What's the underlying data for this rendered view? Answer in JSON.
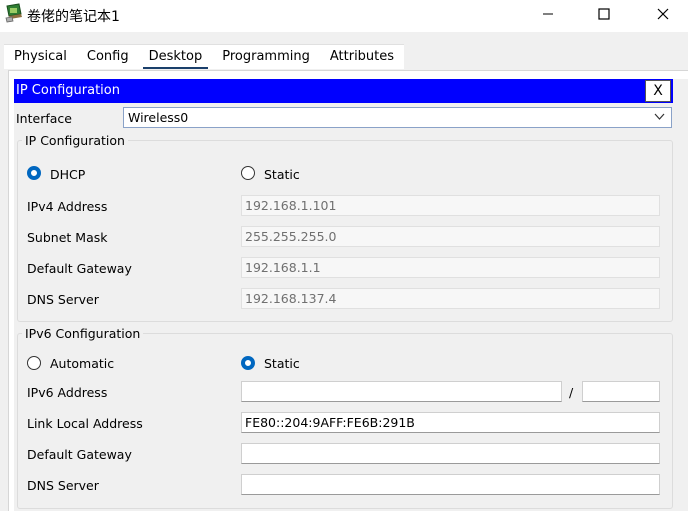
{
  "window": {
    "title": "卷佬的笔记本1"
  },
  "tabs": [
    {
      "label": "Physical"
    },
    {
      "label": "Config"
    },
    {
      "label": "Desktop"
    },
    {
      "label": "Programming"
    },
    {
      "label": "Attributes"
    }
  ],
  "active_tab": "Desktop",
  "ip_config": {
    "header_title": "IP Configuration",
    "close_label": "X",
    "interface_label": "Interface",
    "interface_value": "Wireless0",
    "ipv4_group": {
      "title": "IP Configuration",
      "dhcp_label": "DHCP",
      "static_label": "Static",
      "mode": "DHCP",
      "ipv4_address_label": "IPv4 Address",
      "ipv4_address_value": "192.168.1.101",
      "subnet_mask_label": "Subnet Mask",
      "subnet_mask_value": "255.255.255.0",
      "default_gateway_label": "Default Gateway",
      "default_gateway_value": "192.168.1.1",
      "dns_server_label": "DNS Server",
      "dns_server_value": "192.168.137.4"
    },
    "ipv6_group": {
      "title": "IPv6 Configuration",
      "automatic_label": "Automatic",
      "static_label": "Static",
      "mode": "Static",
      "ipv6_address_label": "IPv6 Address",
      "ipv6_address_value": "",
      "prefix_separator": "/",
      "prefix_value": "",
      "link_local_label": "Link Local Address",
      "link_local_value": "FE80::204:9AFF:FE6B:291B",
      "default_gateway_label": "Default Gateway",
      "default_gateway_value": "",
      "dns_server_label": "DNS Server",
      "dns_server_value": ""
    }
  },
  "colors": {
    "header_bar": "#0000ff",
    "radio_selected": "#0067c0",
    "tab_underline": "#1a3f6b"
  }
}
